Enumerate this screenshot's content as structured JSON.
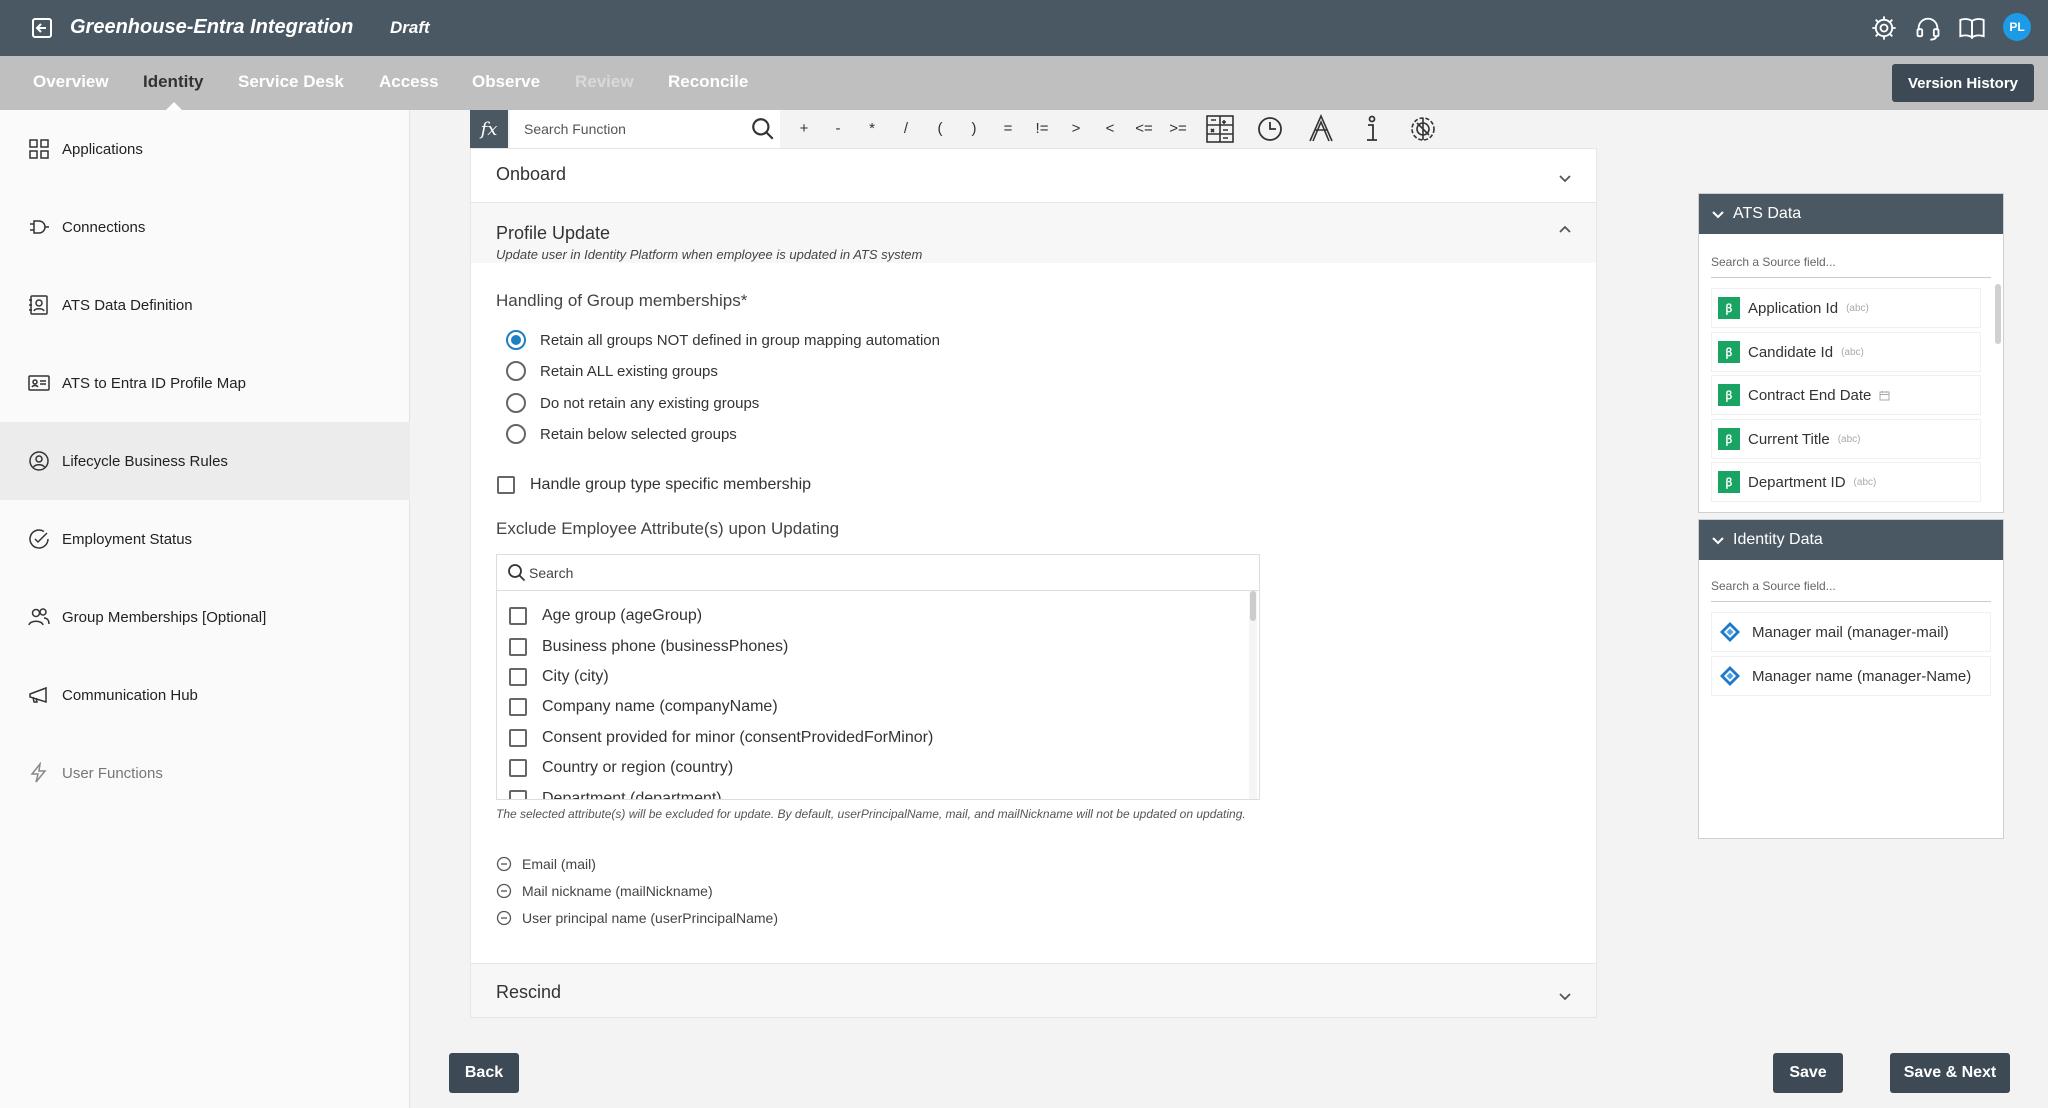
{
  "header": {
    "app_title": "Greenhouse-Entra Integration",
    "status": "Draft",
    "avatar_initials": "PL",
    "icons": [
      "back-icon",
      "gear-icon",
      "headset-icon",
      "book-icon"
    ]
  },
  "nav": {
    "tabs": [
      {
        "label": "Overview",
        "state": "normal"
      },
      {
        "label": "Identity",
        "state": "active"
      },
      {
        "label": "Service Desk",
        "state": "normal"
      },
      {
        "label": "Access",
        "state": "normal"
      },
      {
        "label": "Observe",
        "state": "normal"
      },
      {
        "label": "Review",
        "state": "disabled"
      },
      {
        "label": "Reconcile",
        "state": "normal"
      }
    ],
    "version_history_label": "Version History"
  },
  "sidebar": {
    "items": [
      {
        "label": "Applications",
        "icon": "grid-icon"
      },
      {
        "label": "Connections",
        "icon": "plug-icon"
      },
      {
        "label": "ATS Data Definition",
        "icon": "contact-card-icon"
      },
      {
        "label": "ATS to Entra ID Profile Map",
        "icon": "id-card-icon"
      },
      {
        "label": "Lifecycle Business Rules",
        "icon": "user-circle-icon",
        "active": true
      },
      {
        "label": "Employment Status",
        "icon": "check-circle-icon"
      },
      {
        "label": "Group Memberships [Optional]",
        "icon": "users-icon"
      },
      {
        "label": "Communication Hub",
        "icon": "megaphone-icon"
      },
      {
        "label": "User Functions",
        "icon": "function-bolt-icon",
        "muted": true
      }
    ]
  },
  "toolbar": {
    "fx_label": "fx",
    "search_placeholder": "Search Function",
    "operators": [
      "+",
      "-",
      "*",
      "/",
      "(",
      ")",
      "=",
      "!=",
      ">",
      "<",
      "<=",
      ">="
    ],
    "tools": [
      "table-grid-icon",
      "clock-icon",
      "font-icon",
      "info-icon",
      "brain-gear-icon"
    ]
  },
  "sections": {
    "onboard": {
      "title": "Onboard"
    },
    "profile_update": {
      "title": "Profile Update",
      "description": "Update user in Identity Platform when employee is updated in ATS system",
      "group_label": "Handling of Group memberships*",
      "radio_options": [
        {
          "label": "Retain all groups NOT defined in group mapping automation",
          "selected": true
        },
        {
          "label": "Retain ALL existing groups",
          "selected": false
        },
        {
          "label": "Do not retain any existing groups",
          "selected": false
        },
        {
          "label": "Retain below selected groups",
          "selected": false
        }
      ],
      "handle_group_type_label": "Handle group type specific membership",
      "exclude_label": "Exclude Employee Attribute(s) upon Updating",
      "exclude_search_placeholder": "Search",
      "attributes": [
        "Age group (ageGroup)",
        "Business phone (businessPhones)",
        "City (city)",
        "Company name (companyName)",
        "Consent provided for minor (consentProvidedForMinor)",
        "Country or region (country)",
        "Department (department)"
      ],
      "note": "The selected attribute(s) will be excluded for update. By default, userPrincipalName, mail, and mailNickname will not be updated on updating.",
      "excluded_defaults": [
        "Email (mail)",
        "Mail nickname (mailNickname)",
        "User principal name (userPrincipalName)"
      ]
    },
    "rescind": {
      "title": "Rescind"
    }
  },
  "ats_panel": {
    "title": "ATS Data",
    "search_placeholder": "Search a Source field...",
    "fields": [
      {
        "name": "Application Id",
        "type": "(abc)"
      },
      {
        "name": "Candidate Id",
        "type": "(abc)"
      },
      {
        "name": "Contract End Date",
        "type": "calendar"
      },
      {
        "name": "Current Title",
        "type": "(abc)"
      },
      {
        "name": "Department ID",
        "type": "(abc)"
      }
    ]
  },
  "identity_panel": {
    "title": "Identity Data",
    "search_placeholder": "Search a Source field...",
    "fields": [
      {
        "name": "Manager mail (manager-mail)"
      },
      {
        "name": "Manager name (manager-Name)"
      }
    ]
  },
  "footer": {
    "back_label": "Back",
    "save_label": "Save",
    "save_next_label": "Save & Next"
  },
  "colors": {
    "header_bg": "#4a5864",
    "nav_bg": "#bfbfbf",
    "accent_blue": "#1d7fc4",
    "field_badge_green": "#19a463",
    "avatar_blue": "#1d9be6"
  }
}
